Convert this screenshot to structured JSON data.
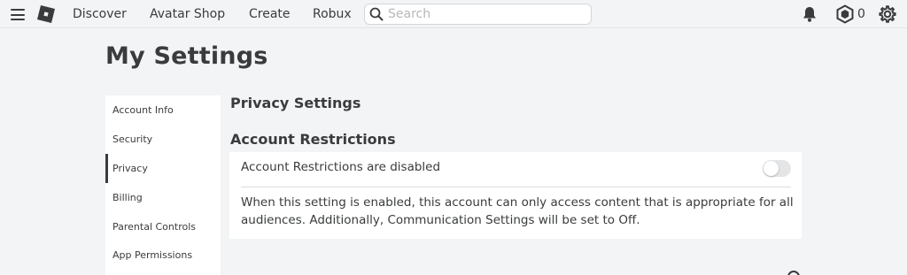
{
  "nav": {
    "links": [
      "Discover",
      "Avatar Shop",
      "Create",
      "Robux"
    ],
    "search_placeholder": "Search",
    "robux_balance": "0",
    "icons": [
      "menu-icon",
      "roblox-logo",
      "search-icon",
      "bell-icon",
      "robux-icon",
      "gear-icon"
    ]
  },
  "page": {
    "title": "My Settings"
  },
  "sidebar": {
    "items": [
      {
        "label": "Account Info",
        "active": false
      },
      {
        "label": "Security",
        "active": false
      },
      {
        "label": "Privacy",
        "active": true
      },
      {
        "label": "Billing",
        "active": false
      },
      {
        "label": "Parental Controls",
        "active": false
      },
      {
        "label": "App Permissions",
        "active": false
      }
    ]
  },
  "main": {
    "privacy_heading": "Privacy Settings",
    "restrictions_heading": "Account Restrictions",
    "restrictions_label": "Account Restrictions are disabled",
    "restrictions_enabled": false,
    "restrictions_description": "When this setting is enabled, this account can only access content that is appropriate for all audiences. Additionally, Communication Settings will be set to Off."
  },
  "colors": {
    "background": "#f2f4f5",
    "card": "#ffffff",
    "text": "#393b3d",
    "toggle_off": "#e3e5e7"
  }
}
